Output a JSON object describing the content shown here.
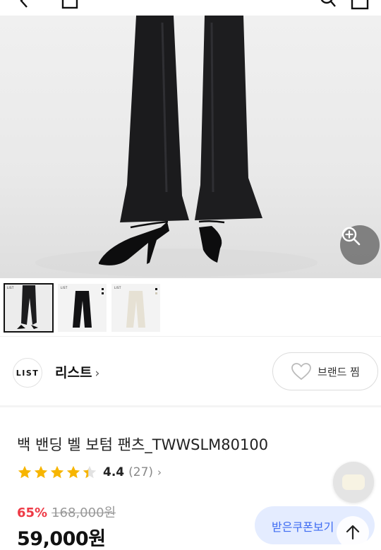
{
  "hero": {
    "zoom_icon": "zoom-in-icon",
    "thumbnails": [
      {
        "label": "LIST",
        "kind": "model-photo",
        "selected": true
      },
      {
        "label": "LIST",
        "kind": "black-pants"
      },
      {
        "label": "LIST",
        "kind": "ivory-pants"
      }
    ]
  },
  "brand": {
    "logo_text": "LIST",
    "name": "리스트",
    "chevron": "›",
    "like_label": "브랜드 찜",
    "like_icon": "heart-outline-icon"
  },
  "product": {
    "title": "백 밴딩 벨 보텀 팬츠_TWWSLM80100",
    "rating": {
      "stars": 4.4,
      "score": "4.4",
      "count": "(27)",
      "chevron": "›"
    },
    "discount": "65%",
    "original_price": "168,000원",
    "price": "59,000원"
  },
  "floating": {
    "coupon_label": "받은쿠폰보기",
    "scroll_top_icon": "arrow-up-icon",
    "recent_item_icon": "recent-product-thumbnail"
  },
  "colors": {
    "accent_discount": "#ee3a46",
    "coupon_text": "#3d6bf2",
    "star": "#f7b500"
  }
}
